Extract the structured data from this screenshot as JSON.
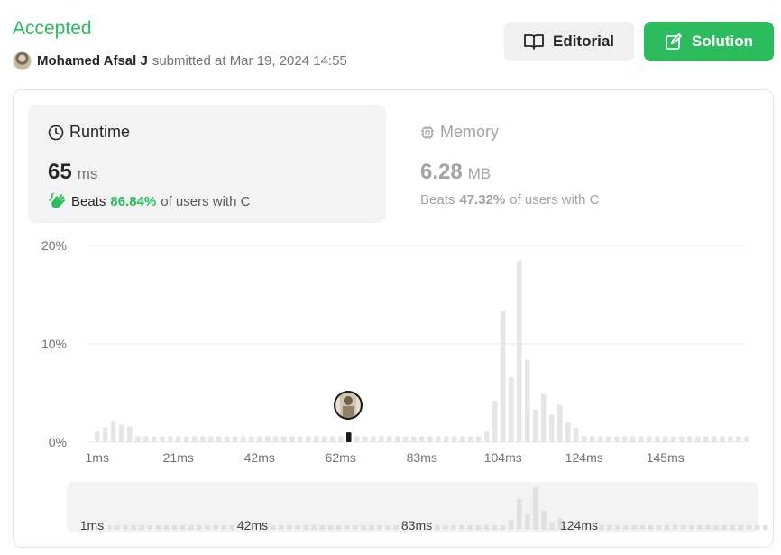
{
  "header": {
    "status": "Accepted",
    "author": "Mohamed Afsal J",
    "submitted_text": "submitted at Mar 19, 2024 14:55"
  },
  "buttons": {
    "editorial": "Editorial",
    "solution": "Solution"
  },
  "runtime": {
    "title": "Runtime",
    "value": "65",
    "unit": "ms",
    "beats_label": "Beats",
    "beats_pct": "86.84%",
    "beats_suffix": "of users with C"
  },
  "memory": {
    "title": "Memory",
    "value": "6.28",
    "unit": "MB",
    "beats_label": "Beats",
    "beats_pct": "47.32%",
    "beats_suffix": "of users with C"
  },
  "colors": {
    "accent_green": "#2cbb5d",
    "bar_default": "#e6e6e6",
    "bar_selected": "#1a1a1a"
  },
  "chart_data": {
    "type": "bar",
    "title": "",
    "xlabel": "",
    "ylabel": "",
    "y_ticks": [
      "20%",
      "10%",
      "0%"
    ],
    "x_ticks": [
      "1ms",
      "21ms",
      "42ms",
      "62ms",
      "83ms",
      "104ms",
      "124ms",
      "145ms"
    ],
    "ylim": [
      0,
      20
    ],
    "selected_index": 31,
    "selected_label": "65ms",
    "values": [
      1.1,
      1.5,
      2.1,
      1.8,
      1.6,
      0.6,
      0.6,
      0.6,
      0.6,
      0.6,
      0.6,
      0.6,
      0.6,
      0.6,
      0.6,
      0.6,
      0.6,
      0.6,
      0.6,
      0.6,
      0.6,
      0.6,
      0.6,
      0.6,
      0.6,
      0.6,
      0.6,
      0.6,
      0.6,
      0.6,
      0.6,
      1.0,
      0.6,
      0.6,
      0.6,
      0.6,
      0.6,
      0.6,
      0.6,
      0.6,
      0.6,
      0.6,
      0.6,
      0.6,
      0.6,
      0.6,
      0.6,
      0.6,
      1.1,
      4.2,
      13.3,
      6.6,
      18.5,
      8.4,
      3.3,
      4.9,
      2.8,
      3.8,
      2.0,
      1.5,
      0.6,
      0.6,
      0.6,
      0.6,
      0.6,
      0.6,
      0.6,
      0.6,
      0.6,
      0.6,
      0.6,
      0.6,
      0.6,
      0.6,
      0.6,
      0.6,
      0.6,
      0.6,
      0.6,
      0.6,
      0.6
    ],
    "mini_ticks": [
      "1ms",
      "42ms",
      "83ms",
      "124ms"
    ],
    "grid": true,
    "legend": "none"
  }
}
